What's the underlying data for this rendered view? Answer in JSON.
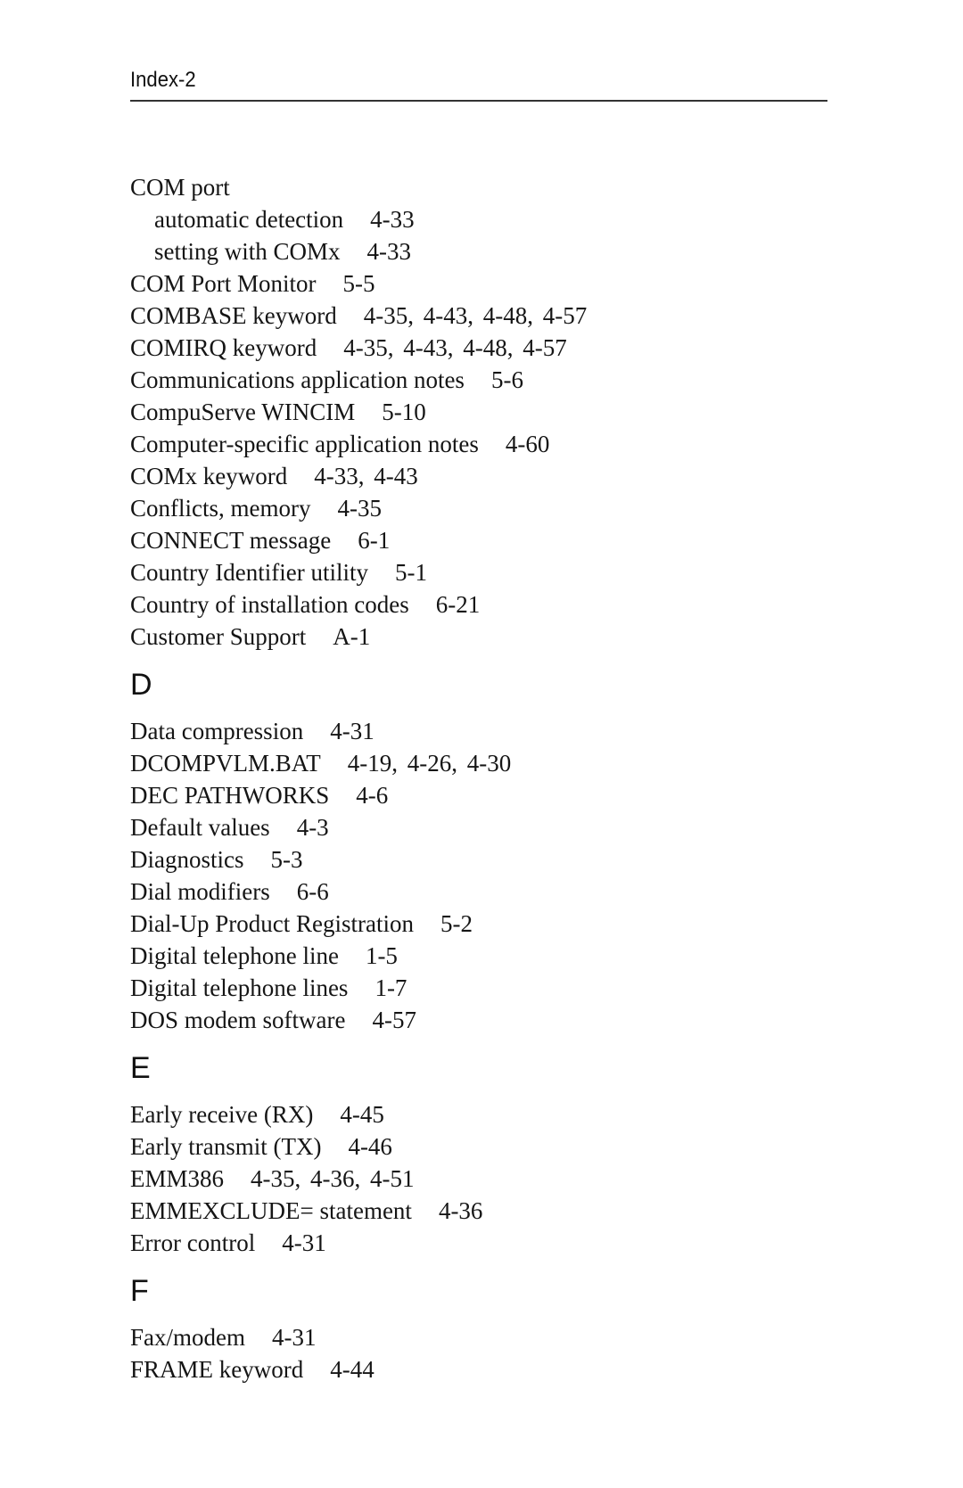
{
  "header": {
    "page_label": "Index-2"
  },
  "sections": [
    {
      "letter": "",
      "entries": [
        {
          "term": "COM port",
          "pages": "",
          "sub": false
        },
        {
          "term": "automatic detection",
          "pages": "4-33",
          "sub": true
        },
        {
          "term": "setting with COMx",
          "pages": "4-33",
          "sub": true
        },
        {
          "term": "COM Port Monitor",
          "pages": "5-5",
          "sub": false
        },
        {
          "term": "COMBASE keyword",
          "pages": "4-35, 4-43, 4-48, 4-57",
          "sub": false
        },
        {
          "term": "COMIRQ keyword",
          "pages": "4-35, 4-43, 4-48, 4-57",
          "sub": false
        },
        {
          "term": "Communications application notes",
          "pages": "5-6",
          "sub": false
        },
        {
          "term": "CompuServe WINCIM",
          "pages": "5-10",
          "sub": false
        },
        {
          "term": "Computer-specific application notes",
          "pages": "4-60",
          "sub": false
        },
        {
          "term": "COMx keyword",
          "pages": "4-33, 4-43",
          "sub": false
        },
        {
          "term": "Conflicts, memory",
          "pages": "4-35",
          "sub": false
        },
        {
          "term": "CONNECT message",
          "pages": "6-1",
          "sub": false
        },
        {
          "term": "Country Identifier utility",
          "pages": "5-1",
          "sub": false
        },
        {
          "term": "Country of installation codes",
          "pages": "6-21",
          "sub": false
        },
        {
          "term": "Customer Support",
          "pages": "A-1",
          "sub": false
        }
      ]
    },
    {
      "letter": "D",
      "entries": [
        {
          "term": "Data compression",
          "pages": "4-31",
          "sub": false
        },
        {
          "term": "DCOMPVLM.BAT",
          "pages": "4-19, 4-26, 4-30",
          "sub": false
        },
        {
          "term": "DEC PATHWORKS",
          "pages": "4-6",
          "sub": false
        },
        {
          "term": "Default values",
          "pages": "4-3",
          "sub": false
        },
        {
          "term": "Diagnostics",
          "pages": "5-3",
          "sub": false
        },
        {
          "term": "Dial modifiers",
          "pages": "6-6",
          "sub": false
        },
        {
          "term": "Dial-Up Product Registration",
          "pages": "5-2",
          "sub": false
        },
        {
          "term": "Digital telephone line",
          "pages": "1-5",
          "sub": false
        },
        {
          "term": "Digital telephone lines",
          "pages": "1-7",
          "sub": false
        },
        {
          "term": "DOS modem software",
          "pages": "4-57",
          "sub": false
        }
      ]
    },
    {
      "letter": "E",
      "entries": [
        {
          "term": "Early receive (RX)",
          "pages": "4-45",
          "sub": false
        },
        {
          "term": "Early transmit (TX)",
          "pages": "4-46",
          "sub": false
        },
        {
          "term": "EMM386",
          "pages": "4-35, 4-36, 4-51",
          "sub": false
        },
        {
          "term": "EMMEXCLUDE= statement",
          "pages": "4-36",
          "sub": false
        },
        {
          "term": "Error control",
          "pages": "4-31",
          "sub": false
        }
      ]
    },
    {
      "letter": "F",
      "entries": [
        {
          "term": "Fax/modem",
          "pages": "4-31",
          "sub": false
        },
        {
          "term": "FRAME keyword",
          "pages": "4-44",
          "sub": false
        }
      ]
    }
  ]
}
